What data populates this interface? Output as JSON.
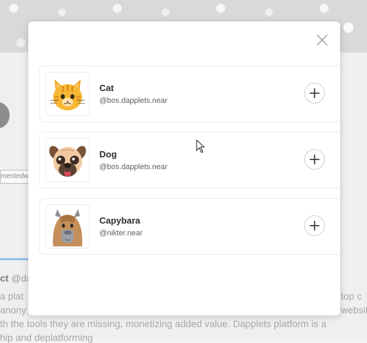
{
  "background": {
    "input_text": "mentedw",
    "handle_name": "ct",
    "handle_rest": " @da",
    "line1": "a plat",
    "line1_right": "top c",
    "line2": "anony",
    "line2_right": "websit",
    "line3": "th the tools they are missing, monetizing added value. Dapplets platform is a",
    "line4": "hip and deplatforming"
  },
  "modal": {
    "items": [
      {
        "name": "Cat",
        "author": "@bos.dapplets.near",
        "icon": "cat-face-icon"
      },
      {
        "name": "Dog",
        "author": "@bos.dapplets.near",
        "icon": "pug-face-icon"
      },
      {
        "name": "Capybara",
        "author": "@nikter.near",
        "icon": "capybara-icon"
      }
    ],
    "close_icon": "close-icon",
    "add_icon": "plus-icon"
  }
}
